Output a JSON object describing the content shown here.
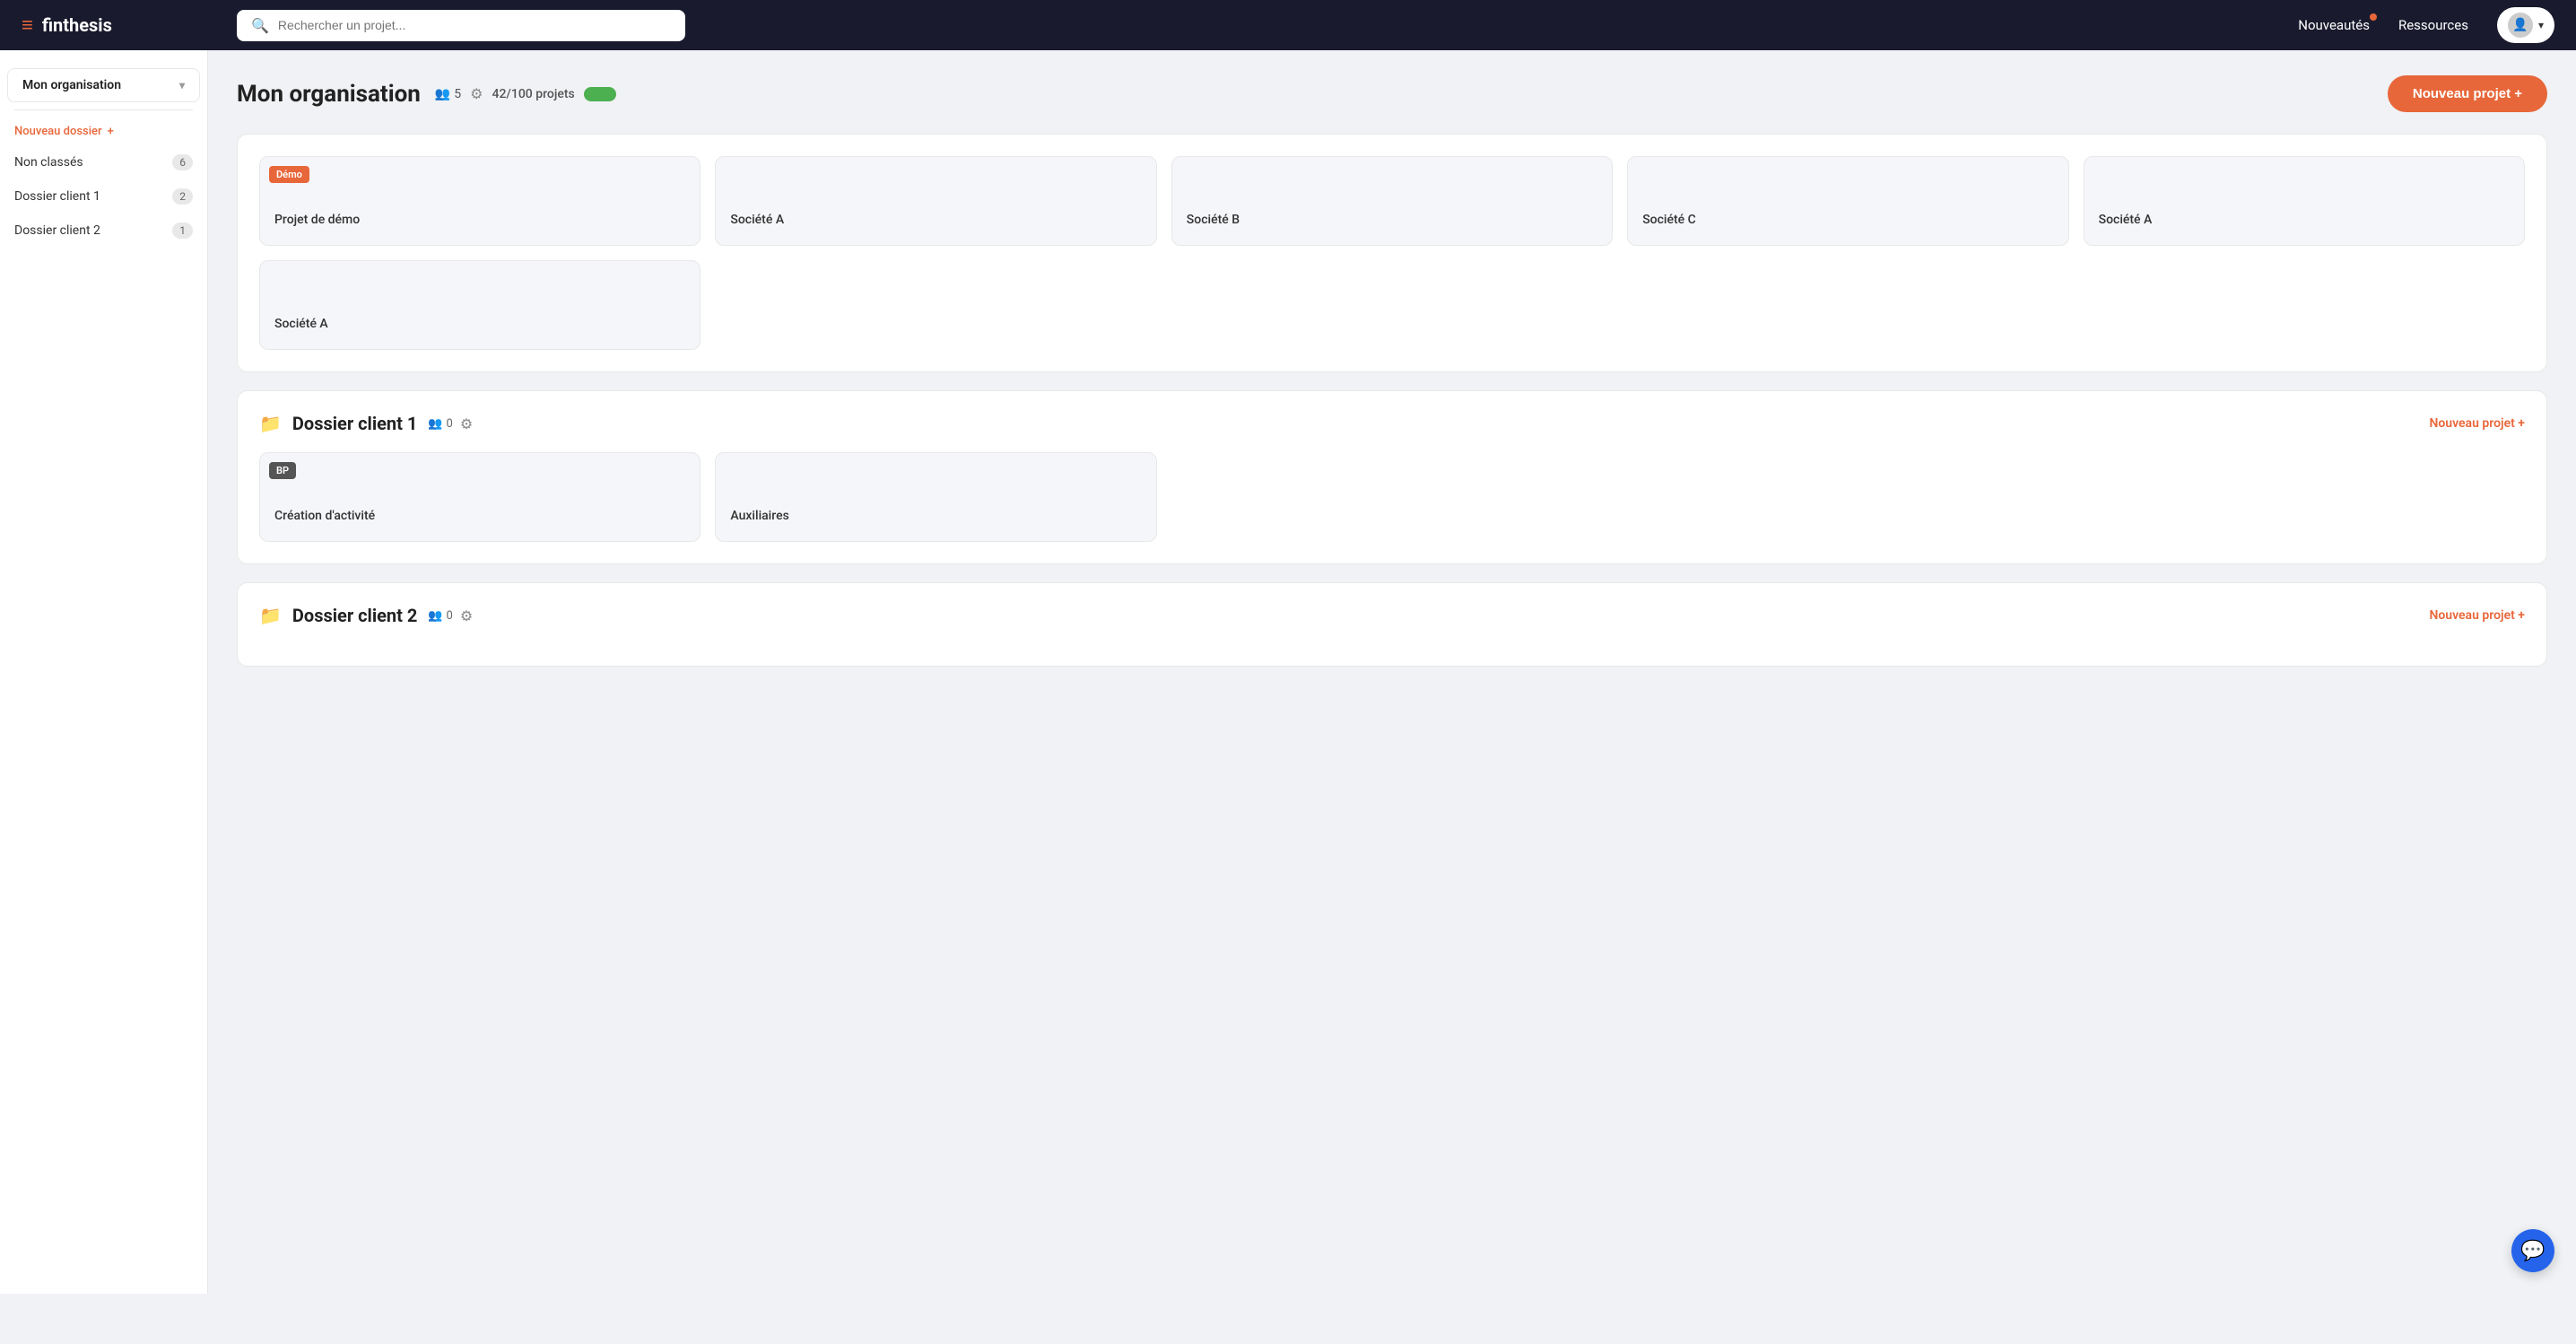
{
  "navbar": {
    "logo_text": "finthesis",
    "search_placeholder": "Rechercher un projet...",
    "nav_links": [
      {
        "label": "Nouveautés",
        "has_dot": true
      },
      {
        "label": "Ressources",
        "has_dot": false
      }
    ]
  },
  "sidebar": {
    "org_label": "Mon organisation",
    "new_folder_label": "Nouveau dossier",
    "new_folder_icon": "+",
    "items": [
      {
        "label": "Non classés",
        "count": "6"
      },
      {
        "label": "Dossier client 1",
        "count": "2"
      },
      {
        "label": "Dossier client 2",
        "count": "1"
      }
    ]
  },
  "main": {
    "page_title": "Mon organisation",
    "users_count": "5",
    "projects_label": "42/100 projets",
    "new_project_btn": "Nouveau projet +",
    "folders": [
      {
        "id": "unclassified",
        "name": null,
        "show_header": false,
        "projects": [
          {
            "label": "Projet de démo",
            "badge": "Démo",
            "badge_class": "badge-demo"
          },
          {
            "label": "Société A",
            "badge": null
          },
          {
            "label": "Société B",
            "badge": null
          },
          {
            "label": "Société C",
            "badge": null
          },
          {
            "label": "Société A",
            "badge": null
          },
          {
            "label": "Société A",
            "badge": null
          }
        ]
      },
      {
        "id": "dossier1",
        "name": "Dossier client 1",
        "show_header": true,
        "users_count": "0",
        "new_project_label": "Nouveau projet +",
        "projects": [
          {
            "label": "Création d'activité",
            "badge": "BP",
            "badge_class": "badge-bp"
          },
          {
            "label": "Auxiliaires",
            "badge": null
          }
        ]
      },
      {
        "id": "dossier2",
        "name": "Dossier client 2",
        "show_header": true,
        "users_count": "0",
        "new_project_label": "Nouveau projet +",
        "projects": []
      }
    ]
  }
}
